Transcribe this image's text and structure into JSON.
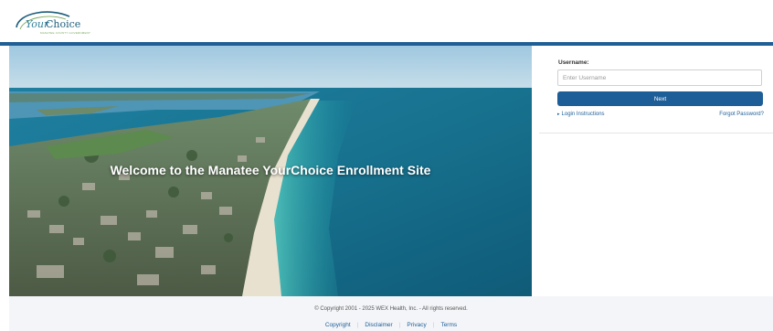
{
  "header": {
    "logo_your": "Your",
    "logo_choice": "Choice",
    "logo_tagline": "MANATEE COUNTY GOVERNMENT"
  },
  "hero": {
    "title": "Welcome to the Manatee YourChoice Enrollment Site"
  },
  "login": {
    "username_label": "Username:",
    "username_placeholder": "Enter Username",
    "username_value": "",
    "next_label": "Next",
    "instructions_link": "Login Instructions",
    "forgot_link": "Forgot Password?"
  },
  "footer": {
    "copyright": "© Copyright 2001 - 2025 WEX Health, Inc. - All rights reserved.",
    "links": [
      "Copyright",
      "Disclaimer",
      "Privacy",
      "Terms"
    ]
  },
  "colors": {
    "brand_blue": "#1e5e98",
    "header_bar": "#1f5f95",
    "footer_bg": "#f3f5f8"
  },
  "icons": {
    "instructions_toggle": "triangle-right-icon"
  }
}
